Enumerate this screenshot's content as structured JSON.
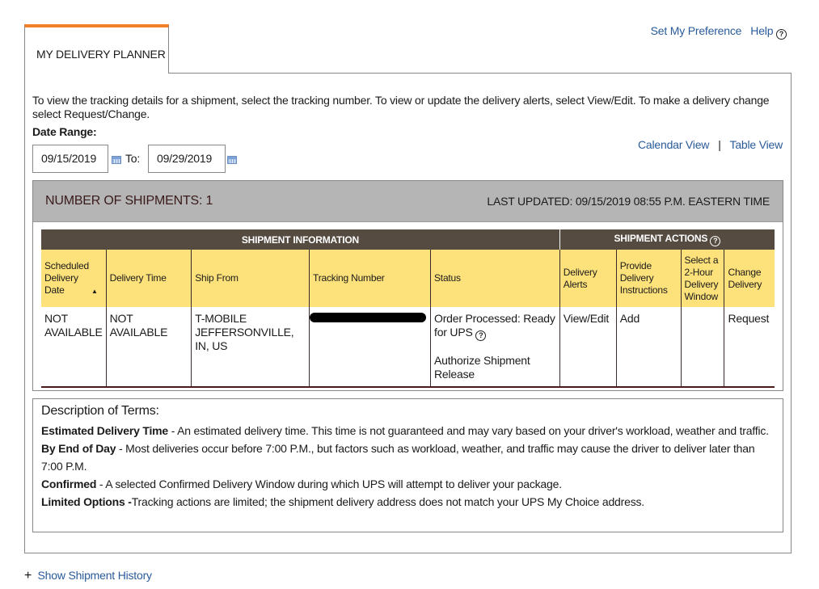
{
  "tab": {
    "label": "MY DELIVERY PLANNER"
  },
  "top_links": {
    "preference": "Set My Preference",
    "help": "Help"
  },
  "intro": "To view the tracking details for a shipment, select the tracking number. To view or update the delivery alerts, select View/Edit. To make a delivery change select Request/Change.",
  "date_range": {
    "label": "Date Range:",
    "from": "09/15/2019",
    "to_label": "To:",
    "to": "09/29/2019"
  },
  "views": {
    "calendar": "Calendar View",
    "sep": "|",
    "table": "Table View"
  },
  "panel": {
    "count": "NUMBER OF SHIPMENTS: 1",
    "updated": "LAST UPDATED: 09/15/2019 08:55 P.M. EASTERN TIME"
  },
  "table": {
    "group_info": "SHIPMENT INFORMATION",
    "group_actions": "SHIPMENT ACTIONS",
    "columns": [
      "Scheduled Delivery Date",
      "Delivery Time",
      "Ship From",
      "Tracking Number",
      "Status",
      "Delivery Alerts",
      "Provide Delivery Instructions",
      "Select a 2-Hour Delivery Window",
      "Change Delivery"
    ],
    "row": {
      "date": "NOT AVAILABLE",
      "time": "NOT AVAILABLE",
      "from": "T-MOBILE JEFFERSONVILLE, IN, US",
      "status": "Order Processed: Ready for UPS",
      "authorize": "Authorize Shipment Release",
      "alerts": "View/Edit",
      "instructions": "Add",
      "window": "",
      "change": "Request"
    }
  },
  "terms": {
    "title": "Description of Terms:",
    "items": [
      {
        "term": "Estimated Delivery Time",
        "text": " - An estimated delivery time. This time is not guaranteed and may vary based on your driver's workload, weather and traffic."
      },
      {
        "term": "By End of Day",
        "text": " - Most deliveries occur before 7:00 P.M., but factors such as workload, weather, and traffic may cause the driver to deliver later than 7:00 P.M."
      },
      {
        "term": "Confirmed",
        "text": " - A selected Confirmed Delivery Window during which UPS will attempt to deliver your package."
      },
      {
        "term": "Limited Options -",
        "text": "Tracking actions are limited; the shipment delivery address does not match your UPS My Choice address."
      }
    ]
  },
  "history": {
    "icon": "+",
    "label": "Show Shipment History"
  }
}
